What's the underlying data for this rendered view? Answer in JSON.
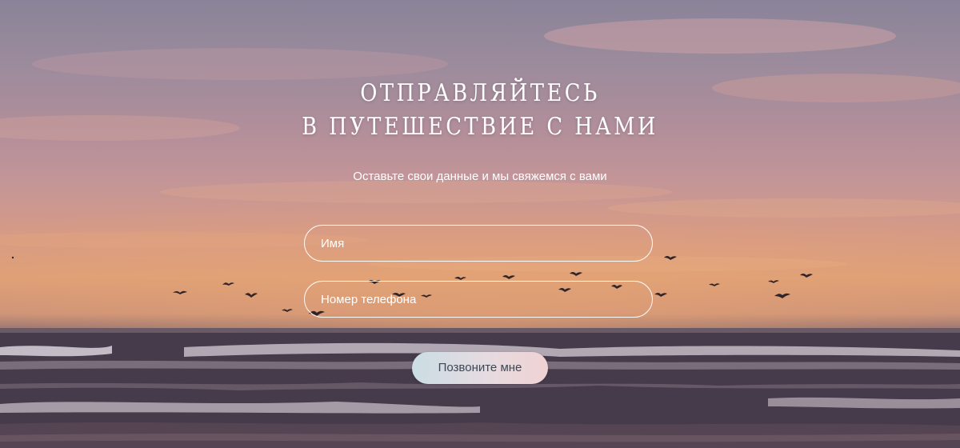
{
  "hero": {
    "title_line1": "Отправляйтесь",
    "title_line2": "в путешествие с нами",
    "subtitle": "Оставьте свои данные и мы свяжемся с вами"
  },
  "form": {
    "name_placeholder": "Имя",
    "phone_placeholder": "Номер телефона",
    "submit_label": "Позвоните мне"
  },
  "colors": {
    "text": "#ffffff",
    "button_text": "#3c4856",
    "button_gradient_start": "#cbdde4",
    "button_gradient_end": "#f0d2d3"
  },
  "background": {
    "scene": "sunset-sea-with-birds-photo"
  }
}
